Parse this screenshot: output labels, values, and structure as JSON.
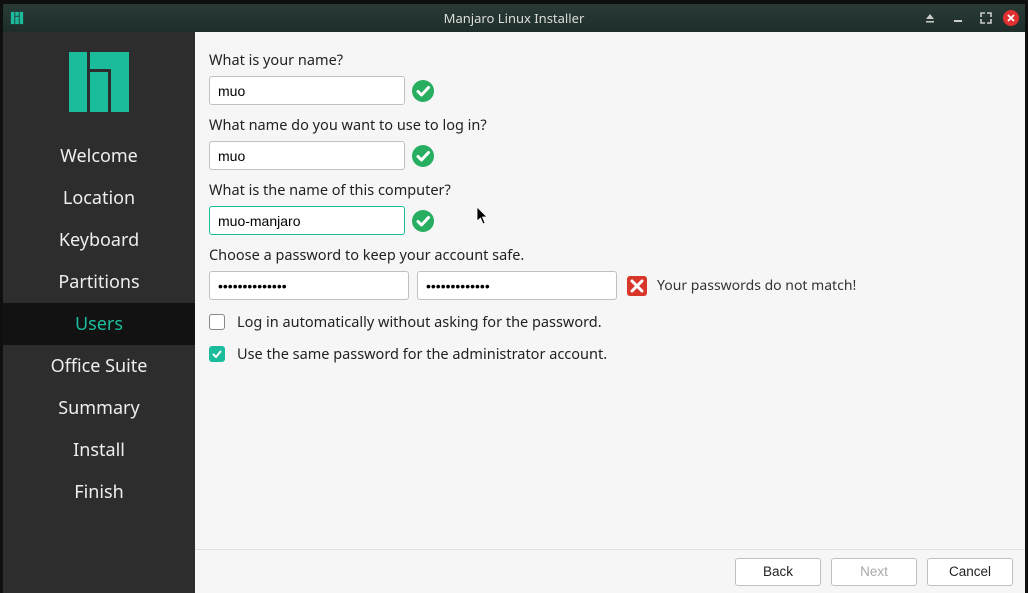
{
  "window": {
    "title": "Manjaro Linux Installer"
  },
  "sidebar": {
    "items": [
      {
        "label": "Welcome"
      },
      {
        "label": "Location"
      },
      {
        "label": "Keyboard"
      },
      {
        "label": "Partitions"
      },
      {
        "label": "Users"
      },
      {
        "label": "Office Suite"
      },
      {
        "label": "Summary"
      },
      {
        "label": "Install"
      },
      {
        "label": "Finish"
      }
    ],
    "active_index": 4
  },
  "form": {
    "name_label": "What is your name?",
    "name_value": "muo",
    "login_label": "What name do you want to use to log in?",
    "login_value": "muo",
    "hostname_label": "What is the name of this computer?",
    "hostname_value": "muo-manjaro",
    "password_label": "Choose a password to keep your account safe.",
    "password_value": "••••••••••••••",
    "password_confirm_value": "•••••••••••••",
    "password_error": "Your passwords do not match!",
    "autologin_label": "Log in automatically without asking for the password.",
    "autologin_checked": false,
    "reuse_pw_label": "Use the same password for the administrator account.",
    "reuse_pw_checked": true
  },
  "footer": {
    "back": "Back",
    "next": "Next",
    "cancel": "Cancel"
  }
}
